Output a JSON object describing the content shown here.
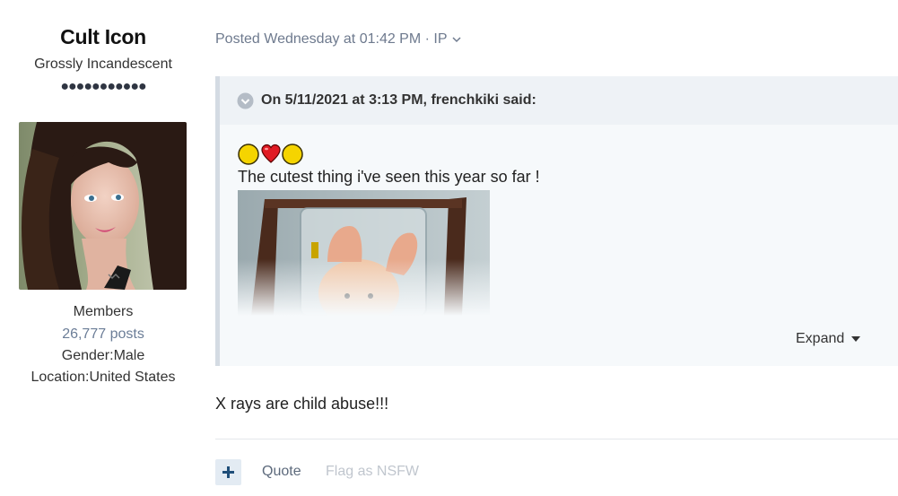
{
  "author": {
    "name": "Cult Icon",
    "title": "Grossly Incandescent",
    "rank_dots": "●●●●●●●●●●●",
    "group": "Members",
    "posts": "26,777 posts",
    "gender": "Gender:Male",
    "location": "Location:United States"
  },
  "post": {
    "meta": "Posted Wednesday at 01:42 PM · IP",
    "body": "X rays are child abuse!!!"
  },
  "quote": {
    "header": "On 5/11/2021 at 3:13 PM, frenchkiki said:",
    "emojis": [
      "yellow-circle",
      "red-heart",
      "yellow-circle"
    ],
    "text": "The cutest thing i've seen this year so far !",
    "expand_label": "Expand"
  },
  "actions": {
    "plus": "+",
    "quote_label": "Quote",
    "flag_label": "Flag as NSFW"
  },
  "colors": {
    "accent": "#6b7d97",
    "quote_bg": "#f6f9fb",
    "quote_head_bg": "#eef2f6",
    "quote_border": "#d4dbe3",
    "plus_btn_bg": "#e3ebf3",
    "plus_btn_fg": "#1f4e79"
  }
}
